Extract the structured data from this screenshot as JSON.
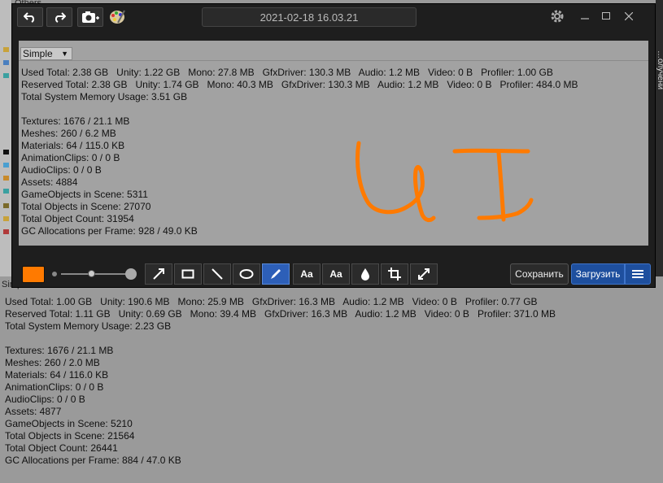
{
  "background": {
    "tab_label": "Others",
    "simple_tab": "Simple",
    "right_vertical_text": "…олучени",
    "stats": [
      "Used Total: 1.00 GB   Unity: 190.6 MB   Mono: 25.9 MB   GfxDriver: 16.3 MB   Audio: 1.2 MB   Video: 0 B   Profiler: 0.77 GB",
      "Reserved Total: 1.11 GB   Unity: 0.69 GB   Mono: 39.4 MB   GfxDriver: 16.3 MB   Audio: 1.2 MB   Video: 0 B   Profiler: 371.0 MB",
      "Total System Memory Usage: 2.23 GB",
      "",
      "Textures: 1676 / 21.1 MB",
      "Meshes: 260 / 2.0 MB",
      "Materials: 64 / 116.0 KB",
      "AnimationClips: 0 / 0 B",
      "AudioClips: 0 / 0 B",
      "Assets: 4877",
      "GameObjects in Scene: 5210",
      "Total Objects in Scene: 21564",
      "Total Object Count: 26441",
      "GC Allocations per Frame: 884 / 47.0 KB"
    ]
  },
  "tool": {
    "title": "2021-02-18 16.03.21",
    "icons": {
      "undo": "undo-icon",
      "redo": "redo-icon",
      "camera": "camera-add-icon",
      "palette": "palette-icon",
      "settings": "gear-icon"
    },
    "canvas": {
      "dropdown_value": "Simple",
      "annotation_text": "UI",
      "annotation_color": "#ff7a00",
      "stats": [
        "Used Total: 2.38 GB   Unity: 1.22 GB   Mono: 27.8 MB   GfxDriver: 130.3 MB   Audio: 1.2 MB   Video: 0 B   Profiler: 1.00 GB",
        "Reserved Total: 2.38 GB   Unity: 1.74 GB   Mono: 40.3 MB   GfxDriver: 130.3 MB   Audio: 1.2 MB   Video: 0 B   Profiler: 484.0 MB",
        "Total System Memory Usage: 3.51 GB",
        "",
        "Textures: 1676 / 21.1 MB",
        "Meshes: 260 / 6.2 MB",
        "Materials: 64 / 115.0 KB",
        "AnimationClips: 0 / 0 B",
        "AudioClips: 0 / 0 B",
        "Assets: 4884",
        "GameObjects in Scene: 5311",
        "Total Objects in Scene: 27070",
        "Total Object Count: 31954",
        "GC Allocations per Frame: 928 / 49.0 KB"
      ]
    },
    "toolbar": {
      "color": "#ff7a00",
      "active_tool": "pen",
      "tools": [
        "arrow",
        "rectangle",
        "line",
        "ellipse",
        "pen",
        "text",
        "text-outline",
        "blur",
        "crop",
        "resize"
      ],
      "text_tool_label": "Aa",
      "save_label": "Сохранить",
      "upload_label": "Загрузить"
    }
  }
}
